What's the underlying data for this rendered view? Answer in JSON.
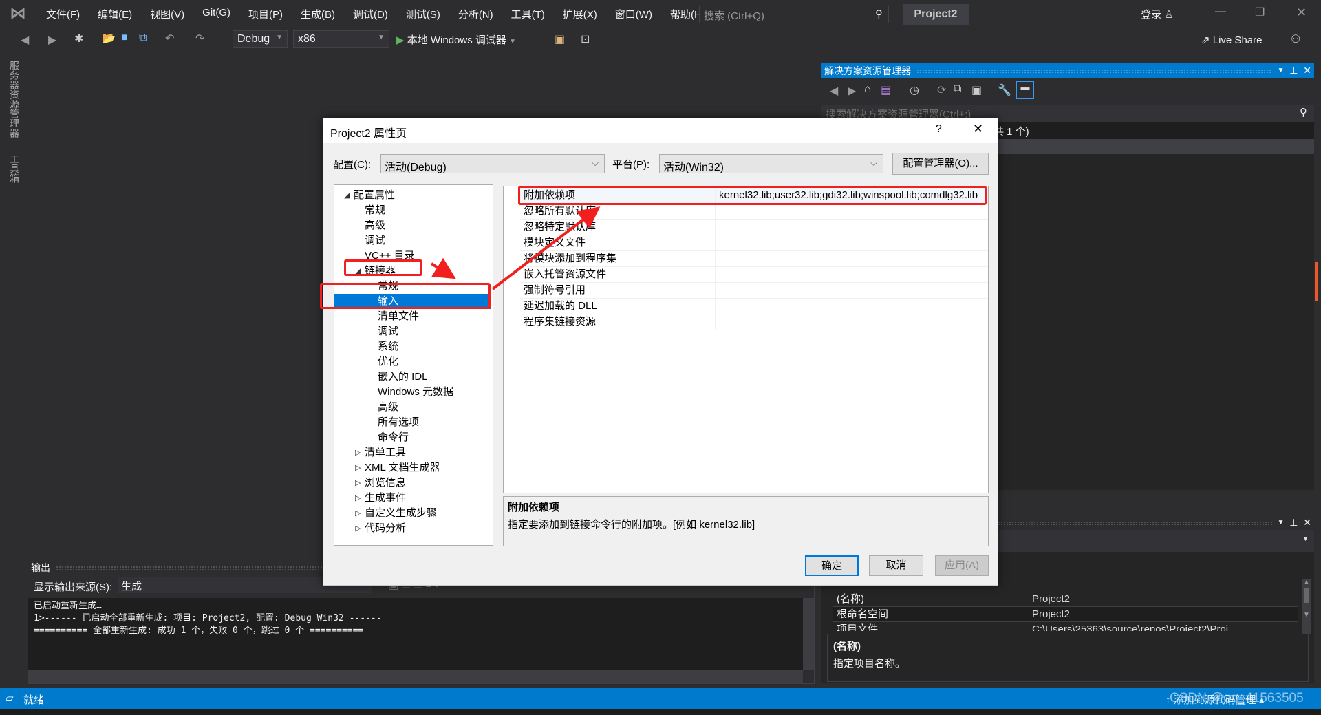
{
  "menubar": {
    "items": [
      "文件(F)",
      "编辑(E)",
      "视图(V)",
      "Git(G)",
      "项目(P)",
      "生成(B)",
      "调试(D)",
      "测试(S)",
      "分析(N)",
      "工具(T)",
      "扩展(X)",
      "窗口(W)",
      "帮助(H)"
    ],
    "search_placeholder": "搜索 (Ctrl+Q)",
    "project_name": "Project2",
    "login": "登录"
  },
  "toolbar": {
    "config": "Debug",
    "platform": "x86",
    "run_label": "本地 Windows 调试器",
    "live_share": "Live Share"
  },
  "side_tabs": [
    "服务器资源管理器",
    "工具箱"
  ],
  "solution_explorer": {
    "title": "解决方案资源管理器",
    "search_placeholder": "搜索解决方案资源管理器(Ctrl+;)",
    "row_text": "共 1 个)"
  },
  "properties_panel": {
    "rows": [
      {
        "name": "(名称)",
        "value": "Project2"
      },
      {
        "name": "根命名空间",
        "value": "Project2"
      },
      {
        "name": "项目文件",
        "value": "C:\\Users\\25363\\source\\repos\\Project2\\Proj..."
      }
    ],
    "desc_title": "(名称)",
    "desc_text": "指定项目名称。"
  },
  "output": {
    "title": "输出",
    "source_label": "显示输出来源(S):",
    "source_value": "生成",
    "lines": [
      "已启动重新生成…",
      "1>------ 已启动全部重新生成: 项目: Project2, 配置: Debug Win32 ------",
      "========== 全部重新生成: 成功 1 个，失败 0 个，跳过 0 个 =========="
    ]
  },
  "status": {
    "text": "就绪",
    "right": "↑ 添加到源代码管理 ▴",
    "watermark": "CSDN @qq_41563505"
  },
  "dialog": {
    "title": "Project2 属性页",
    "help": "?",
    "config_label": "配置(C):",
    "config_value": "活动(Debug)",
    "platform_label": "平台(P):",
    "platform_value": "活动(Win32)",
    "config_manager": "配置管理器(O)...",
    "tree": [
      {
        "label": "配置属性",
        "level": 0,
        "expander": "open"
      },
      {
        "label": "常规",
        "level": 1
      },
      {
        "label": "高级",
        "level": 1
      },
      {
        "label": "调试",
        "level": 1
      },
      {
        "label": "VC++ 目录",
        "level": 1
      },
      {
        "label": "链接器",
        "level": 1,
        "expander": "open"
      },
      {
        "label": "常规",
        "level": 2
      },
      {
        "label": "输入",
        "level": 2,
        "selected": true
      },
      {
        "label": "清单文件",
        "level": 2
      },
      {
        "label": "调试",
        "level": 2
      },
      {
        "label": "系统",
        "level": 2
      },
      {
        "label": "优化",
        "level": 2
      },
      {
        "label": "嵌入的 IDL",
        "level": 2
      },
      {
        "label": "Windows 元数据",
        "level": 2
      },
      {
        "label": "高级",
        "level": 2
      },
      {
        "label": "所有选项",
        "level": 2
      },
      {
        "label": "命令行",
        "level": 2
      },
      {
        "label": "清单工具",
        "level": 1,
        "expander": "closed"
      },
      {
        "label": "XML 文档生成器",
        "level": 1,
        "expander": "closed"
      },
      {
        "label": "浏览信息",
        "level": 1,
        "expander": "closed"
      },
      {
        "label": "生成事件",
        "level": 1,
        "expander": "closed"
      },
      {
        "label": "自定义生成步骤",
        "level": 1,
        "expander": "closed"
      },
      {
        "label": "代码分析",
        "level": 1,
        "expander": "closed"
      }
    ],
    "props": [
      {
        "name": "附加依赖项",
        "value": "kernel32.lib;user32.lib;gdi32.lib;winspool.lib;comdlg32.lib"
      },
      {
        "name": "忽略所有默认库",
        "value": ""
      },
      {
        "name": "忽略特定默认库",
        "value": ""
      },
      {
        "name": "模块定义文件",
        "value": ""
      },
      {
        "name": "将模块添加到程序集",
        "value": ""
      },
      {
        "name": "嵌入托管资源文件",
        "value": ""
      },
      {
        "name": "强制符号引用",
        "value": ""
      },
      {
        "name": "延迟加载的 DLL",
        "value": ""
      },
      {
        "name": "程序集链接资源",
        "value": ""
      }
    ],
    "desc_title": "附加依赖项",
    "desc_text": "指定要添加到链接命令行的附加项。[例如 kernel32.lib]",
    "ok": "确定",
    "cancel": "取消",
    "apply": "应用(A)"
  },
  "colors": {
    "accent": "#007acc",
    "annotation": "#f21f1f",
    "selection": "#0078d7"
  }
}
